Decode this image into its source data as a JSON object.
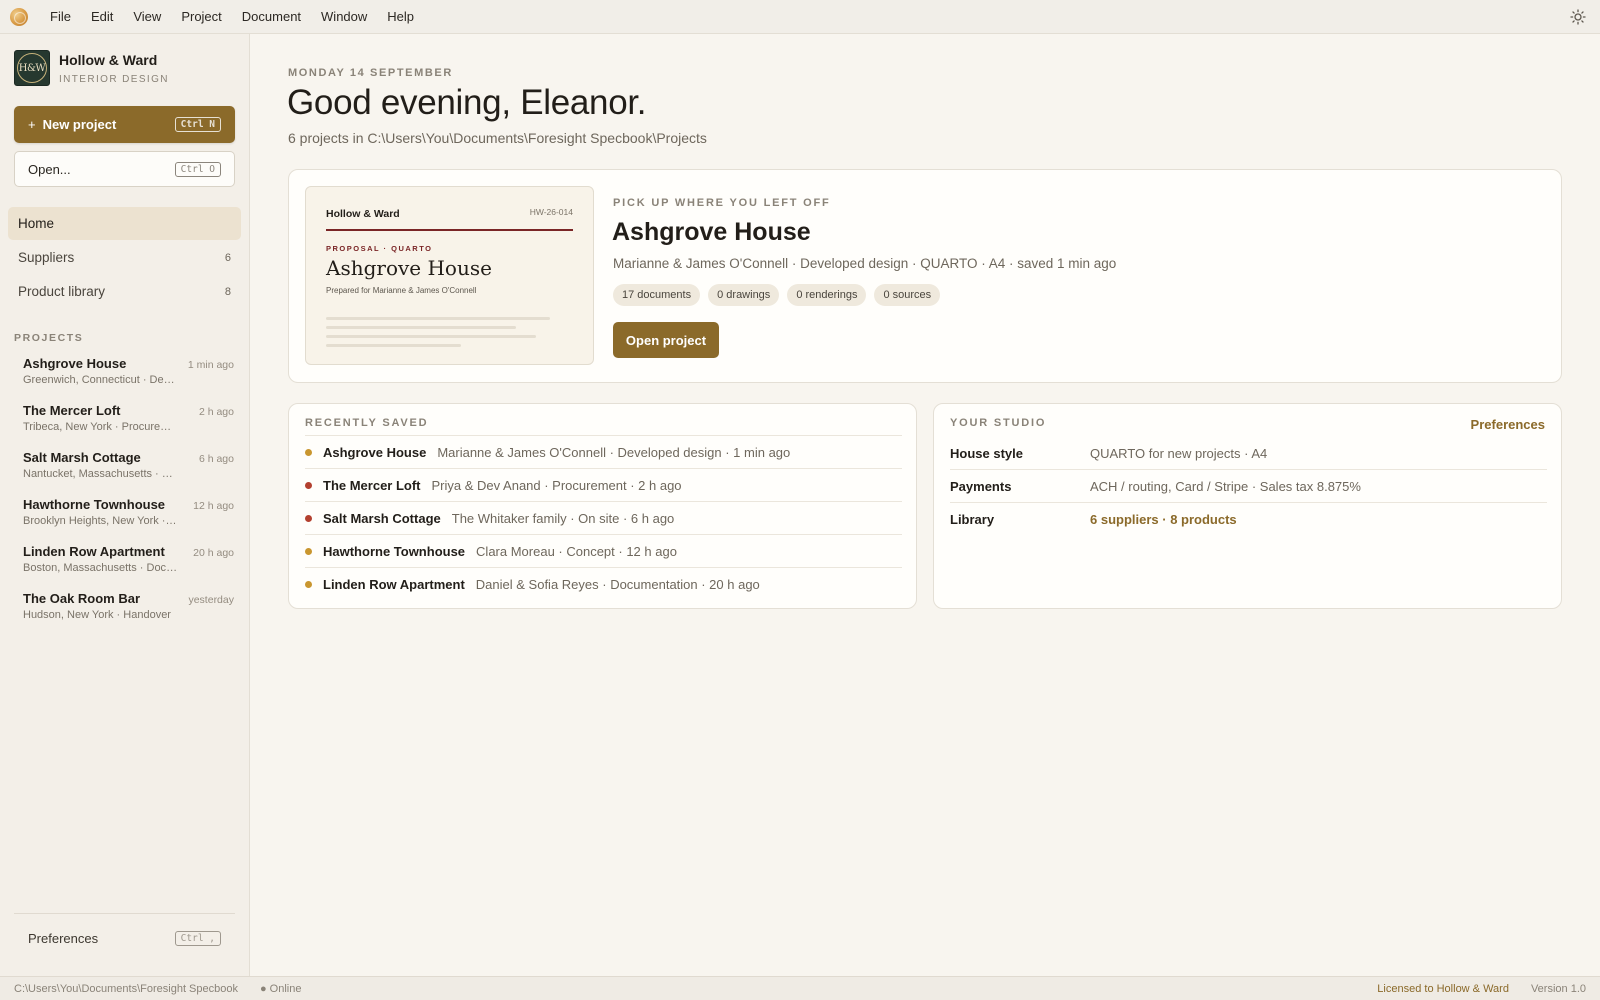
{
  "menubar": {
    "items": [
      "File",
      "Edit",
      "View",
      "Project",
      "Document",
      "Window",
      "Help"
    ]
  },
  "sidebar": {
    "brand": {
      "mark": "H&W",
      "name": "Hollow & Ward",
      "subtitle": "INTERIOR DESIGN"
    },
    "new_project": {
      "label": "New project",
      "shortcut": "Ctrl N"
    },
    "open": {
      "label": "Open...",
      "shortcut": "Ctrl O"
    },
    "nav": [
      {
        "label": "Home",
        "count": ""
      },
      {
        "label": "Suppliers",
        "count": "6"
      },
      {
        "label": "Product library",
        "count": "8"
      }
    ],
    "projects_label": "PROJECTS",
    "projects": [
      {
        "name": "Ashgrove House",
        "meta": "Greenwich, Connecticut · Developed design",
        "time": "1 min ago"
      },
      {
        "name": "The Mercer Loft",
        "meta": "Tribeca, New York · Procurement",
        "time": "2 h ago"
      },
      {
        "name": "Salt Marsh Cottage",
        "meta": "Nantucket, Massachusetts · On site",
        "time": "6 h ago"
      },
      {
        "name": "Hawthorne Townhouse",
        "meta": "Brooklyn Heights, New York · Concept",
        "time": "12 h ago"
      },
      {
        "name": "Linden Row Apartment",
        "meta": "Boston, Massachusetts · Documentation",
        "time": "20 h ago"
      },
      {
        "name": "The Oak Room Bar",
        "meta": "Hudson, New York · Handover",
        "time": "yesterday"
      }
    ],
    "preferences": {
      "label": "Preferences",
      "shortcut": "Ctrl ,"
    }
  },
  "main": {
    "date": "MONDAY 14 SEPTEMBER",
    "greeting": "Good evening, Eleanor.",
    "subline": "6 projects in C:\\Users\\You\\Documents\\Foresight Specbook\\Projects",
    "hero": {
      "kicker": "PICK UP WHERE YOU LEFT OFF",
      "title": "Ashgrove House",
      "meta": "Marianne & James O'Connell · Developed design · QUARTO · A4 · saved 1 min ago",
      "chips": [
        "17 documents",
        "0 drawings",
        "0 renderings",
        "0 sources"
      ],
      "open_label": "Open project",
      "preview": {
        "firm": "Hollow & Ward",
        "code": "HW-26-014",
        "kicker": "PROPOSAL · QUARTO",
        "title": "Ashgrove House",
        "prepared": "Prepared for Marianne & James O'Connell"
      }
    },
    "recent": {
      "kicker": "RECENTLY SAVED",
      "rows": [
        {
          "name": "Ashgrove House",
          "detail": "Marianne & James O'Connell · Developed design · 1 min ago",
          "dot_color": "#c9962f"
        },
        {
          "name": "The Mercer Loft",
          "detail": "Priya & Dev Anand · Procurement · 2 h ago",
          "dot_color": "#b3402f"
        },
        {
          "name": "Salt Marsh Cottage",
          "detail": "The Whitaker family · On site · 6 h ago",
          "dot_color": "#b3402f"
        },
        {
          "name": "Hawthorne Townhouse",
          "detail": "Clara Moreau · Concept · 12 h ago",
          "dot_color": "#c9962f"
        },
        {
          "name": "Linden Row Apartment",
          "detail": "Daniel & Sofia Reyes · Documentation · 20 h ago",
          "dot_color": "#c9962f"
        }
      ]
    },
    "studio": {
      "kicker": "YOUR STUDIO",
      "preferences_link": "Preferences",
      "rows": [
        {
          "key": "House style",
          "value": "QUARTO for new projects · A4"
        },
        {
          "key": "Payments",
          "value": "ACH / routing, Card / Stripe · Sales tax 8.875%"
        },
        {
          "key": "Library",
          "value": "6 suppliers · 8 products"
        }
      ]
    }
  },
  "statusbar": {
    "path": "C:\\Users\\You\\Documents\\Foresight Specbook",
    "online": "● Online",
    "license": "Licensed to Hollow & Ward",
    "version": "Version 1.0"
  },
  "colors": {
    "accent": "#8b6a2a",
    "background": "#f8f5ef",
    "sidebar": "#f3efe8",
    "brand_mark": "#26382f",
    "doc_rule": "#7a2526"
  },
  "icons": [
    "app-logo-icon",
    "sun-icon"
  ]
}
